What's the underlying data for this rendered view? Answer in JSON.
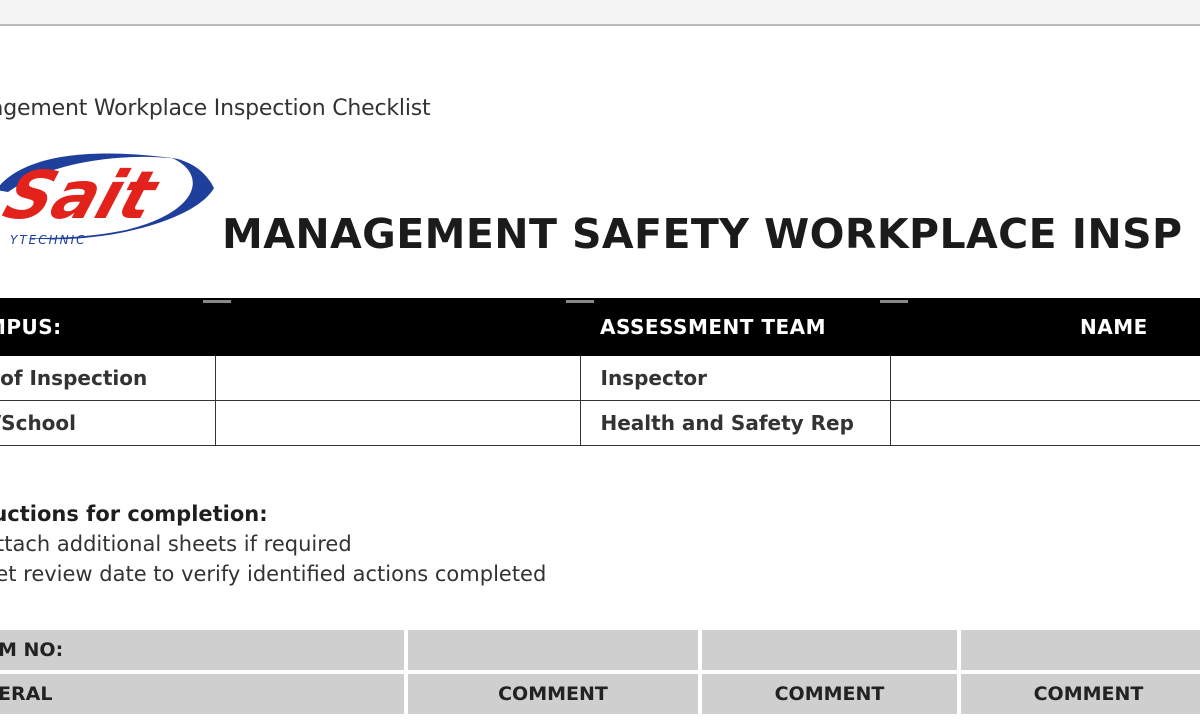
{
  "document": {
    "header_line": "agement Workplace Inspection Checklist",
    "main_title": "MANAGEMENT SAFETY WORKPLACE INSP",
    "logo": {
      "wordmark": "Sait",
      "subtext": "YTECHNIC",
      "primary_color": "#e3231b",
      "secondary_color": "#1f3f9c"
    }
  },
  "info_table": {
    "headers": [
      "AMPUS:",
      "",
      "ASSESSMENT TEAM",
      "NAME"
    ],
    "rows": [
      {
        "label": "te of Inspection",
        "value": "",
        "role": "Inspector",
        "name": ""
      },
      {
        "label": "pt/School",
        "value": "",
        "role": "Health and Safety Rep",
        "name": ""
      }
    ]
  },
  "instructions": {
    "title": "ructions for completion:",
    "items": [
      "Attach additional sheets if required",
      "Set review date to verify identified actions completed"
    ]
  },
  "checklist_table": {
    "row1": [
      "M NO:",
      "",
      "",
      ""
    ],
    "row2": [
      "ERAL",
      "COMMENT",
      "COMMENT",
      "COMMENT"
    ]
  }
}
